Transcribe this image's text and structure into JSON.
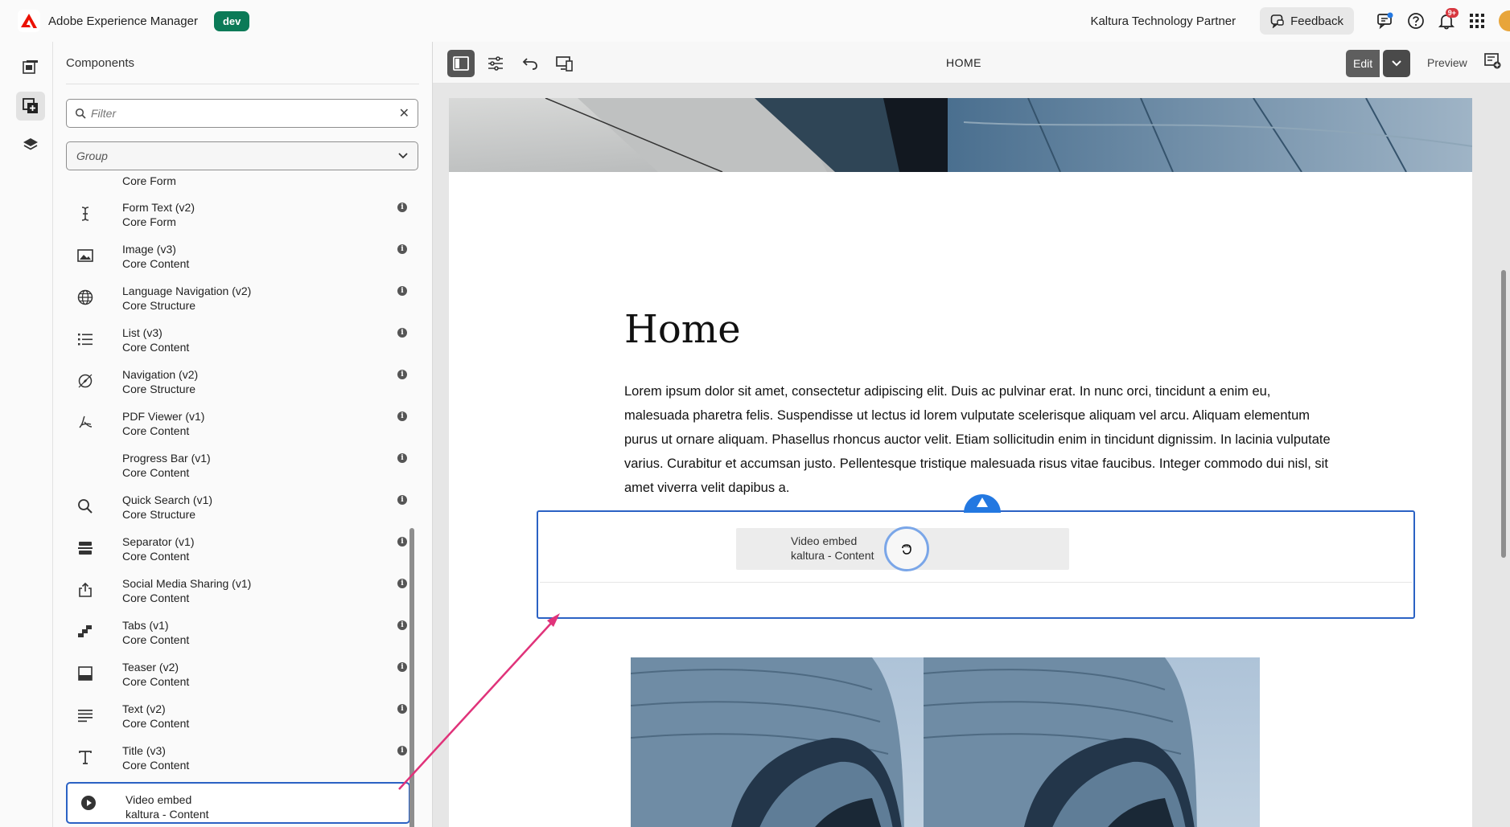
{
  "topbar": {
    "app_name": "Adobe Experience Manager",
    "env_badge": "dev",
    "partner": "Kaltura Technology Partner",
    "feedback_label": "Feedback",
    "notifications_count": "9+",
    "icons": [
      "chat-icon",
      "help-icon",
      "bell-icon",
      "apps-grid-icon"
    ]
  },
  "rail": {
    "items": [
      "page-tree-icon",
      "components-icon",
      "layers-icon"
    ]
  },
  "panel": {
    "title": "Components",
    "filter_placeholder": "Filter",
    "group_label": "Group",
    "top_partial_group": "Core Form",
    "items": [
      {
        "name": "Form Text (v2)",
        "group": "Core Form",
        "icon": "text-cursor-icon"
      },
      {
        "name": "Image (v3)",
        "group": "Core Content",
        "icon": "image-icon"
      },
      {
        "name": "Language Navigation (v2)",
        "group": "Core Structure",
        "icon": "globe-icon"
      },
      {
        "name": "List (v3)",
        "group": "Core Content",
        "icon": "list-icon"
      },
      {
        "name": "Navigation (v2)",
        "group": "Core Structure",
        "icon": "compass-icon"
      },
      {
        "name": "PDF Viewer (v1)",
        "group": "Core Content",
        "icon": "pdf-icon"
      },
      {
        "name": "Progress Bar (v1)",
        "group": "Core Content",
        "icon": "progress-icon"
      },
      {
        "name": "Quick Search (v1)",
        "group": "Core Structure",
        "icon": "search-icon"
      },
      {
        "name": "Separator (v1)",
        "group": "Core Content",
        "icon": "separator-icon"
      },
      {
        "name": "Social Media Sharing (v1)",
        "group": "Core Content",
        "icon": "share-icon"
      },
      {
        "name": "Tabs (v1)",
        "group": "Core Content",
        "icon": "tabs-icon"
      },
      {
        "name": "Teaser (v2)",
        "group": "Core Content",
        "icon": "teaser-icon"
      },
      {
        "name": "Text (v2)",
        "group": "Core Content",
        "icon": "text-align-icon"
      },
      {
        "name": "Title (v3)",
        "group": "Core Content",
        "icon": "title-icon"
      }
    ],
    "selected_item": {
      "name": "Video embed",
      "group": "kaltura - Content",
      "icon": "play-icon"
    }
  },
  "editor_toolbar": {
    "page_name": "HOME",
    "edit_label": "Edit",
    "preview_label": "Preview",
    "icons": [
      "side-panel-icon",
      "properties-icon",
      "undo-icon",
      "emulator-icon",
      "annotations-icon"
    ]
  },
  "page": {
    "heading": "Home",
    "body": "Lorem ipsum dolor sit amet, consectetur adipiscing elit. Duis ac pulvinar erat. In nunc orci, tincidunt a enim eu, malesuada pharetra felis. Suspendisse ut lectus id lorem vulputate scelerisque aliquam vel arcu. Aliquam elementum purus ut ornare aliquam. Phasellus rhoncus auctor velit. Etiam sollicitudin enim in tincidunt dignissim. In lacinia vulputate varius. Curabitur et accumsan justo. Pellentesque tristique malesuada risus vitae faucibus. Integer commodo dui nisl, sit amet viverra velit dapibus a.",
    "drag_ghost": {
      "name": "Video embed",
      "group": "kaltura - Content"
    }
  },
  "colors": {
    "accent_blue": "#2b62c4",
    "badge_green": "#0b7a57",
    "arrow_pink": "#e0337a",
    "notif_red": "#d7373f"
  }
}
